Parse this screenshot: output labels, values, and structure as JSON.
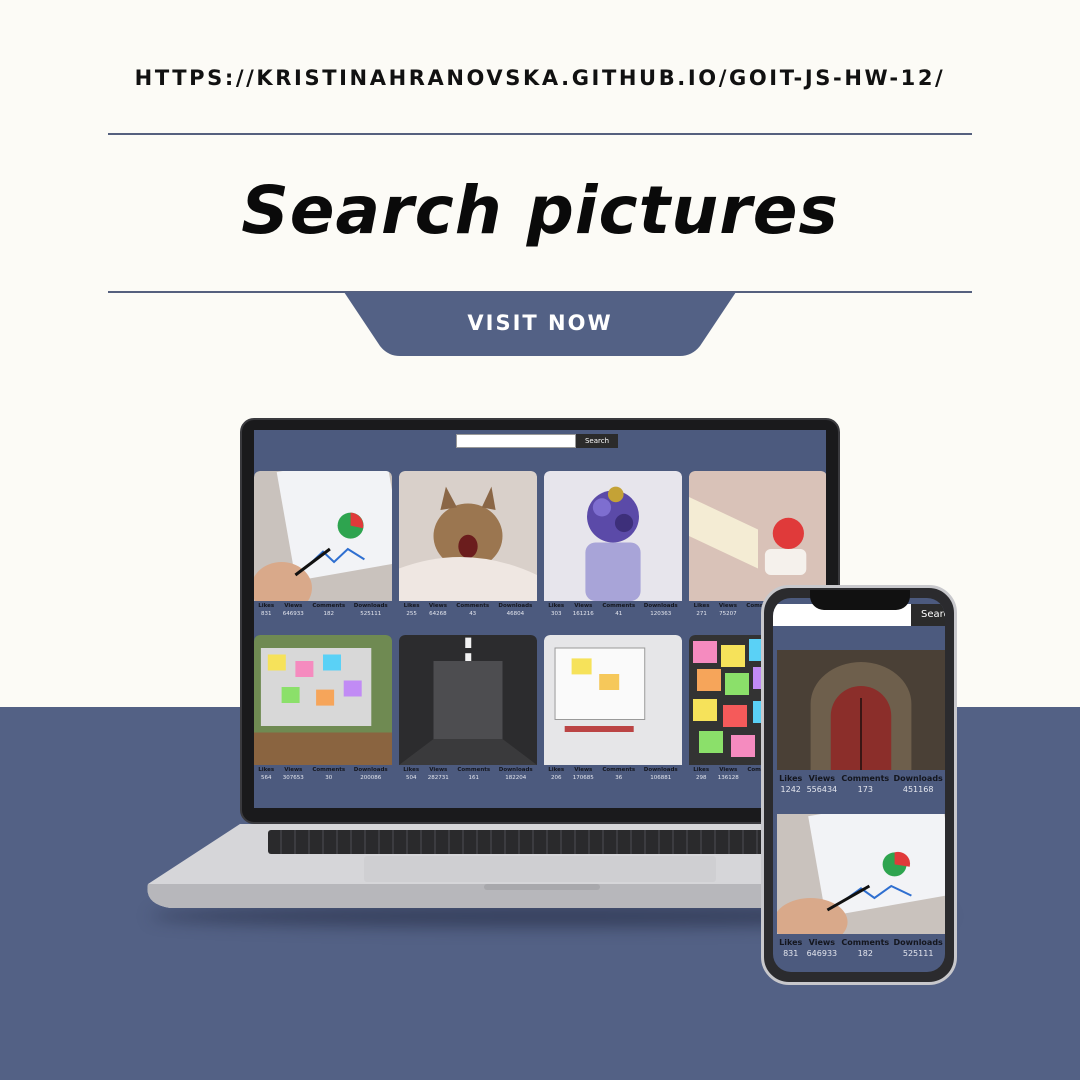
{
  "url": "HTTPS://KRISTINAHRANOVSKA.GITHUB.IO/GOIT-JS-HW-12/",
  "title": "Search pictures",
  "cta": "VISIT NOW",
  "colors": {
    "accent": "#536185",
    "background": "#fcfbf6",
    "screen_bg": "#4c5a7e"
  },
  "laptop": {
    "search_button": "Search",
    "stat_labels": [
      "Likes",
      "Views",
      "Comments",
      "Downloads"
    ],
    "cards": [
      {
        "image": "tablet-analytics-chart",
        "values": [
          "831",
          "646933",
          "182",
          "525111"
        ]
      },
      {
        "image": "yawning-cat-on-bed",
        "values": [
          "255",
          "64268",
          "43",
          "46804"
        ]
      },
      {
        "image": "woman-with-flower-bouquet-face",
        "values": [
          "303",
          "161216",
          "41",
          "120363"
        ]
      },
      {
        "image": "open-book-and-flower-cup",
        "values": [
          "271",
          "75207",
          "",
          ""
        ]
      },
      {
        "image": "laptop-covered-with-sticky-notes",
        "values": [
          "564",
          "307653",
          "30",
          "200086"
        ]
      },
      {
        "image": "empty-dark-room",
        "values": [
          "504",
          "282731",
          "161",
          "182204"
        ]
      },
      {
        "image": "whiteboard-with-notes",
        "values": [
          "206",
          "170685",
          "36",
          "106881"
        ]
      },
      {
        "image": "colorful-sticky-notes-wall",
        "values": [
          "298",
          "136128",
          "",
          ""
        ]
      }
    ]
  },
  "phone": {
    "search_button": "Searc",
    "stat_labels": [
      "Likes",
      "Views",
      "Comments",
      "Downloads"
    ],
    "cards": [
      {
        "image": "ornate-stone-doorway",
        "values": [
          "1242",
          "556434",
          "173",
          "451168"
        ]
      },
      {
        "image": "tablet-analytics-chart",
        "values": [
          "831",
          "646933",
          "182",
          "525111"
        ]
      }
    ]
  }
}
